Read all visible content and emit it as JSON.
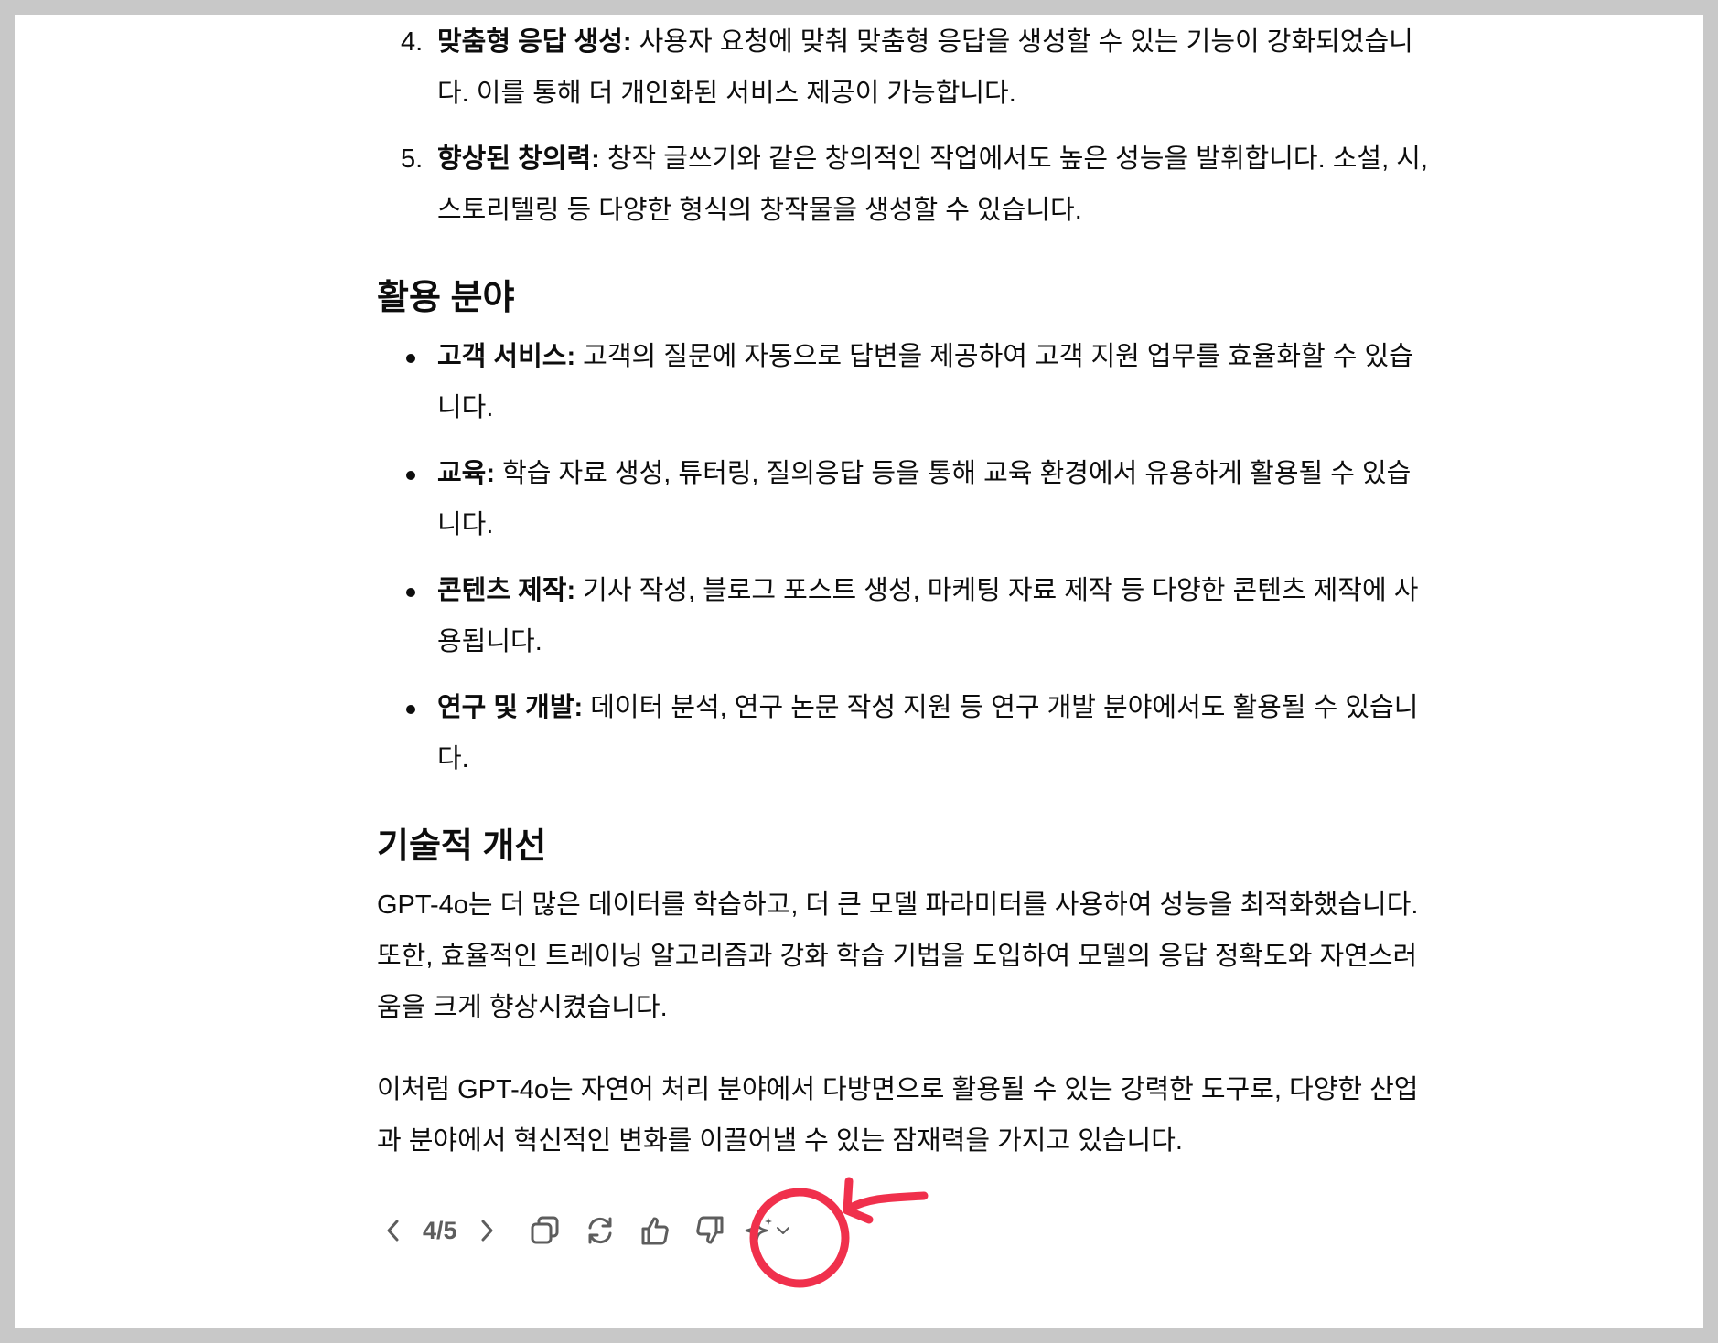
{
  "ordered_items": [
    {
      "number": "4.",
      "term": "맞춤형 응답 생성:",
      "text": " 사용자 요청에 맞춰 맞춤형 응답을 생성할 수 있는 기능이 강화되었습니",
      "text2": "다. 이를 통해 더 개인화된 서비스 제공이 가능합니다."
    },
    {
      "number": "5.",
      "term": "향상된 창의력:",
      "text": " 창작 글쓰기와 같은 창의적인 작업에서도 높은 성능을 발휘합니다. 소설, 시,",
      "text2": "스토리텔링 등 다양한 형식의 창작물을 생성할 수 있습니다."
    }
  ],
  "section_applications": {
    "heading": "활용 분야",
    "items": [
      {
        "term": "고객 서비스:",
        "text": " 고객의 질문에 자동으로 답변을 제공하여 고객 지원 업무를 효율화할 수 있습",
        "text2": "니다."
      },
      {
        "term": "교육:",
        "text": " 학습 자료 생성, 튜터링, 질의응답 등을 통해 교육 환경에서 유용하게 활용될 수 있습",
        "text2": "니다."
      },
      {
        "term": "콘텐츠 제작:",
        "text": " 기사 작성, 블로그 포스트 생성, 마케팅 자료 제작 등 다양한 콘텐츠 제작에 사",
        "text2": "용됩니다."
      },
      {
        "term": "연구 및 개발:",
        "text": " 데이터 분석, 연구 논문 작성 지원 등 연구 개발 분야에서도 활용될 수 있습니",
        "text2": "다."
      }
    ]
  },
  "section_technical": {
    "heading": "기술적 개선",
    "paragraph_lines": [
      "GPT-4o는 더 많은 데이터를 학습하고, 더 큰 모델 파라미터를 사용하여 성능을 최적화했습니다.",
      "또한, 효율적인 트레이닝 알고리즘과 강화 학습 기법을 도입하여 모델의 응답 정확도와 자연스러",
      "움을 크게 향상시켰습니다."
    ]
  },
  "conclusion_lines": [
    "이처럼 GPT-4o는 자연어 처리 분야에서 다방면으로 활용될 수 있는 강력한 도구로, 다양한 산업",
    "과 분야에서 혁신적인 변화를 이끌어낼 수 있는 잠재력을 가지고 있습니다."
  ],
  "toolbar": {
    "pager": "4/5",
    "icons": [
      "chevron-left-icon",
      "chevron-right-icon",
      "copy-icon",
      "regenerate-icon",
      "thumbs-up-icon",
      "thumbs-down-icon",
      "sparkle-icon",
      "chevron-down-icon"
    ]
  },
  "colors": {
    "text": "#0d0d0d",
    "icon": "#5d5d5d",
    "annotation": "#f0304c",
    "frame": "#c8c8c8"
  }
}
